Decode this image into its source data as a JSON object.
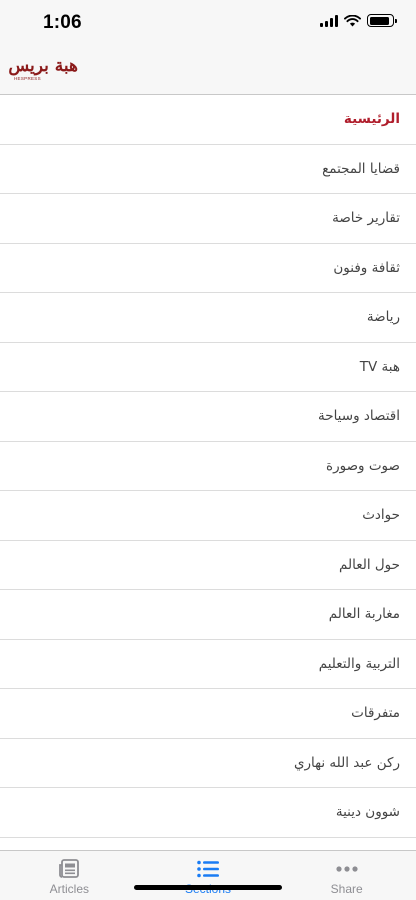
{
  "status_bar": {
    "time": "1:06",
    "icons": [
      "signal-icon",
      "wifi-icon",
      "battery-icon"
    ],
    "battery_level": 0.9
  },
  "nav_bar": {
    "logo_text": "هبة بريس",
    "logo_latin": "HESPRESS"
  },
  "menu": {
    "items": [
      {
        "label": "الرئيسية",
        "active": true
      },
      {
        "label": "قضايا المجتمع",
        "active": false
      },
      {
        "label": "تقارير خاصة",
        "active": false
      },
      {
        "label": "ثقافة وفنون",
        "active": false
      },
      {
        "label": "رياضة",
        "active": false
      },
      {
        "label": "هبة TV",
        "active": false
      },
      {
        "label": "اقتصاد وسياحة",
        "active": false
      },
      {
        "label": "صوت وصورة",
        "active": false
      },
      {
        "label": "حوادث",
        "active": false
      },
      {
        "label": "حول العالم",
        "active": false
      },
      {
        "label": "مغاربة العالم",
        "active": false
      },
      {
        "label": "التربية والتعليم",
        "active": false
      },
      {
        "label": "متفرقات",
        "active": false
      },
      {
        "label": "ركن عبد الله نهاري",
        "active": false
      },
      {
        "label": "شوون دينية",
        "active": false
      }
    ]
  },
  "tab_bar": {
    "tabs": [
      {
        "label": "Articles",
        "icon": "newspaper-icon",
        "active": false
      },
      {
        "label": "Sections",
        "icon": "list-icon",
        "active": true
      },
      {
        "label": "Share",
        "icon": "more-dots-icon",
        "active": false
      }
    ]
  },
  "colors": {
    "active_menu": "#b01e2c",
    "active_tab": "#1a7cf4",
    "inactive_tab": "#8e8e93",
    "logo": "#8b1a1a"
  }
}
